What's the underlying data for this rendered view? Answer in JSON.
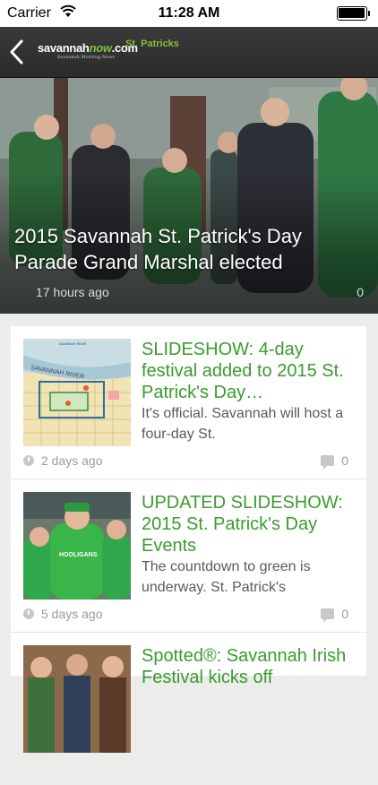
{
  "status_bar": {
    "carrier": "Carrier",
    "time": "11:28 AM"
  },
  "nav": {
    "logo_brand_a": "savannah",
    "logo_brand_b": "now",
    "logo_brand_c": ".com",
    "logo_sub": "Savannah Morning News",
    "section": "St. Patricks",
    "accent": "#7fbf3f"
  },
  "hero": {
    "title": "2015 Savannah St. Patrick's Day Parade Grand Marshal elected",
    "time": "17 hours ago",
    "comments": "0"
  },
  "map_thumb": {
    "river_label": "SAVANNAH RIVER",
    "top_label": "SAVANNAH RIVER"
  },
  "articles": [
    {
      "headline": "SLIDESHOW: 4-day festival added to 2015 St. Patrick's Day…",
      "snippet": "It's official. Savannah will host a four-day St.",
      "time": "2 days ago",
      "comments": "0",
      "thumb": "festival-map-image"
    },
    {
      "headline": "UPDATED SLIDESHOW: 2015 St. Patrick's Day Events",
      "snippet": "The countdown to green is underway. St. Patrick's",
      "time": "5 days ago",
      "comments": "0",
      "thumb": "hooligans-crowd-photo",
      "shirt_text": "HOOLIGANS"
    },
    {
      "headline": "Spotted®: Savannah Irish Festival kicks off",
      "snippet": "",
      "time": "",
      "comments": "",
      "thumb": "irish-festival-photo"
    }
  ],
  "colors": {
    "headline_green": "#3a9b2e",
    "nav_bg": "#2f2f2f",
    "feed_bg": "#ececea"
  }
}
